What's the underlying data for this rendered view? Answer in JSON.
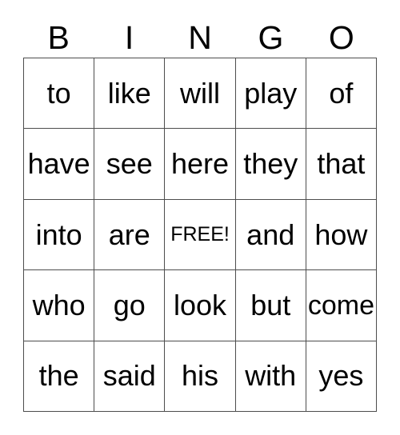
{
  "card": {
    "header": {
      "letters": [
        "B",
        "I",
        "N",
        "G",
        "O"
      ]
    },
    "grid": {
      "columns": 5,
      "rows": 5,
      "border_color": "#4d4d4d",
      "background_color": "#ffffff",
      "text_color": "#000000",
      "free_space": {
        "label": "FREE!",
        "row": 3,
        "column": 3
      },
      "rows_data": [
        [
          "to",
          "like",
          "will",
          "play",
          "of"
        ],
        [
          "have",
          "see",
          "here",
          "they",
          "that"
        ],
        [
          "into",
          "are",
          "FREE!",
          "and",
          "how"
        ],
        [
          "who",
          "go",
          "look",
          "but",
          "come"
        ],
        [
          "the",
          "said",
          "his",
          "with",
          "yes"
        ]
      ]
    }
  }
}
